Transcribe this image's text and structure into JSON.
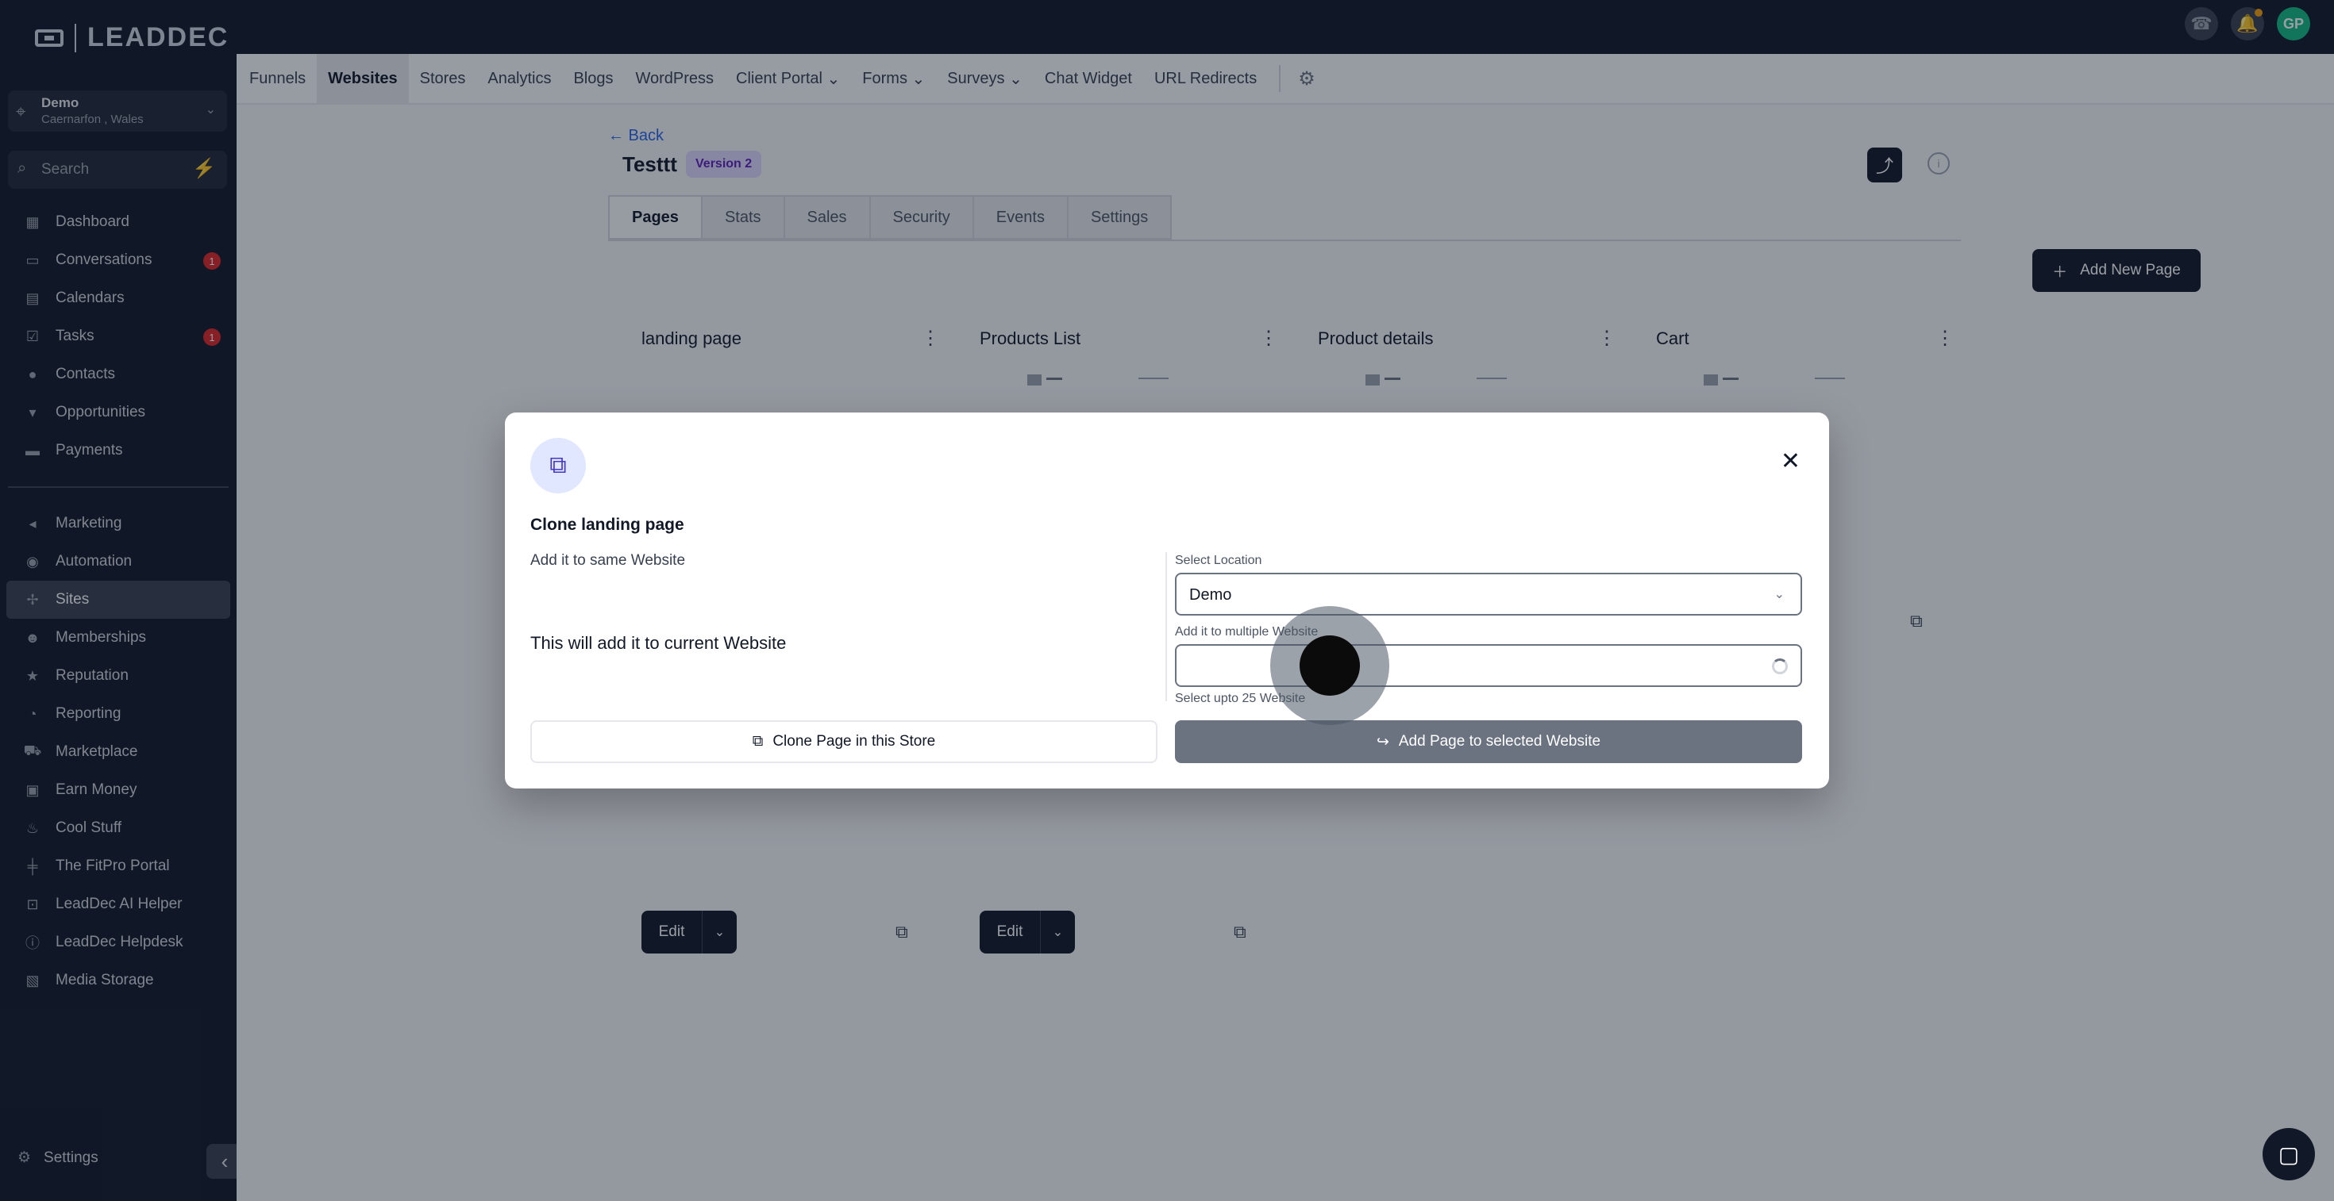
{
  "brand": {
    "name": "LEADDEC"
  },
  "topbar": {
    "avatar_initials": "GP"
  },
  "location": {
    "name": "Demo",
    "address": "Caernarfon , Wales"
  },
  "sidebar": {
    "search_placeholder": "Search",
    "items": [
      {
        "label": "Dashboard",
        "icon": "grid-icon"
      },
      {
        "label": "Conversations",
        "icon": "chat-icon",
        "badge": "1"
      },
      {
        "label": "Calendars",
        "icon": "calendar-icon"
      },
      {
        "label": "Tasks",
        "icon": "check-icon",
        "badge": "1"
      },
      {
        "label": "Contacts",
        "icon": "user-icon"
      },
      {
        "label": "Opportunities",
        "icon": "funnel-icon"
      },
      {
        "label": "Payments",
        "icon": "card-icon"
      }
    ],
    "items2": [
      {
        "label": "Marketing",
        "icon": "megaphone-icon"
      },
      {
        "label": "Automation",
        "icon": "automation-icon"
      },
      {
        "label": "Sites",
        "icon": "sites-icon",
        "active": true
      },
      {
        "label": "Memberships",
        "icon": "members-icon"
      },
      {
        "label": "Reputation",
        "icon": "star-icon"
      },
      {
        "label": "Reporting",
        "icon": "chart-icon"
      },
      {
        "label": "Marketplace",
        "icon": "cart-icon"
      },
      {
        "label": "Earn Money",
        "icon": "money-icon"
      },
      {
        "label": "Cool Stuff",
        "icon": "flame-icon"
      },
      {
        "label": "The FitPro Portal",
        "icon": "dumbbell-icon"
      },
      {
        "label": "LeadDec AI Helper",
        "icon": "robot-icon"
      },
      {
        "label": "LeadDec Helpdesk",
        "icon": "info-icon"
      },
      {
        "label": "Media Storage",
        "icon": "image-icon"
      }
    ],
    "settings_label": "Settings"
  },
  "subnav": {
    "items": [
      "Funnels",
      "Websites",
      "Stores",
      "Analytics",
      "Blogs",
      "WordPress",
      "Client Portal",
      "Forms",
      "Surveys",
      "Chat Widget",
      "URL Redirects"
    ],
    "active": "Websites"
  },
  "page": {
    "back_label": "← Back",
    "title": "Testtt",
    "version": "Version 2",
    "tabs": [
      "Pages",
      "Stats",
      "Sales",
      "Security",
      "Events",
      "Settings"
    ],
    "add_page_label": "Add New Page",
    "cards": [
      {
        "title": "landing page",
        "edit_label": "Edit"
      },
      {
        "title": "Products List",
        "edit_label": "Edit"
      },
      {
        "title": "Product details"
      },
      {
        "title": "Cart"
      }
    ]
  },
  "modal": {
    "title": "Clone landing page",
    "left_heading": "Add it to same Website",
    "left_note": "This will add it to current Website",
    "clone_button": "Clone Page in this Store",
    "location_label": "Select Location",
    "location_value": "Demo",
    "multi_label": "Add it to multiple Website",
    "multi_hint": "Select upto 25 Website",
    "add_button": "Add Page to selected Website"
  },
  "colors": {
    "dark": "#111827",
    "accent": "#2563eb",
    "badge": "#dc2626"
  }
}
